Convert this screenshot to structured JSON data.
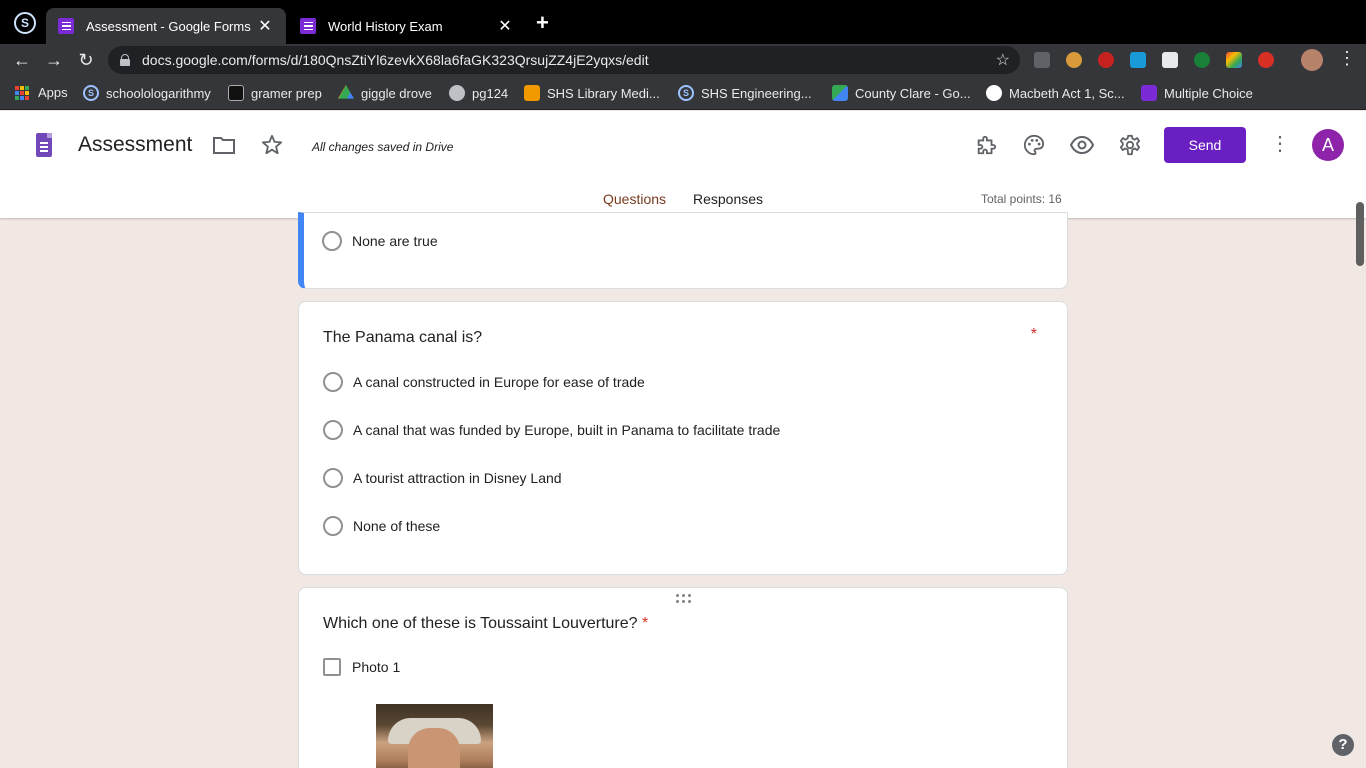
{
  "browser": {
    "tabs": [
      {
        "title": "Assessment - Google Forms",
        "active": true
      },
      {
        "title": "World History Exam",
        "active": false
      }
    ],
    "url": "docs.google.com/forms/d/180QnsZtiYl6zevkX68la6faGK323QrsujZZ4jE2yqxs/edit",
    "bookmarks": [
      {
        "label": "Apps",
        "icon": "apps-grid-icon"
      },
      {
        "label": "schoolologarithmy",
        "icon": "schoology-icon"
      },
      {
        "label": "gramer prep",
        "icon": "gb-icon"
      },
      {
        "label": "giggle drove",
        "icon": "google-drive-icon"
      },
      {
        "label": "pg124",
        "icon": "globe-icon"
      },
      {
        "label": "SHS Library Medi...",
        "icon": "library-icon"
      },
      {
        "label": "SHS Engineering...",
        "icon": "schoology-icon"
      },
      {
        "label": "County Clare - Go...",
        "icon": "maps-icon"
      },
      {
        "label": "Macbeth Act 1, Sc...",
        "icon": "analytics-icon"
      },
      {
        "label": "Multiple Choice",
        "icon": "forms-icon"
      }
    ],
    "extensions": [
      "crx-icon",
      "owl-icon",
      "adblock-icon",
      "checkmark-ext-icon",
      "briefcase-icon",
      "grammarly-icon",
      "color-wheel-icon",
      "red-check-icon"
    ]
  },
  "form": {
    "title": "Assessment",
    "save_status": "All changes saved in Drive",
    "send_label": "Send",
    "avatar_letter": "A",
    "tabs": {
      "questions": "Questions",
      "responses": "Responses"
    },
    "total_points": "Total points: 16",
    "colors": {
      "accent": "#6a1fc2",
      "tab_active": "#7a3b1e",
      "background": "#f1e8e3",
      "focus_bar": "#4285f4",
      "required": "#d93025"
    }
  },
  "questions": [
    {
      "options": [
        "None are true"
      ]
    },
    {
      "title": "The Panama canal is?",
      "required_mark": "*",
      "options": [
        "A canal constructed in Europe for ease of trade",
        "A canal that was funded by Europe, built in Panama to facilitate trade",
        "A tourist attraction in Disney Land",
        "None of these"
      ]
    },
    {
      "title": "Which one of these is Toussaint Louverture?",
      "required_mark": "*",
      "options": [
        "Photo 1"
      ]
    }
  ],
  "help_label": "?"
}
